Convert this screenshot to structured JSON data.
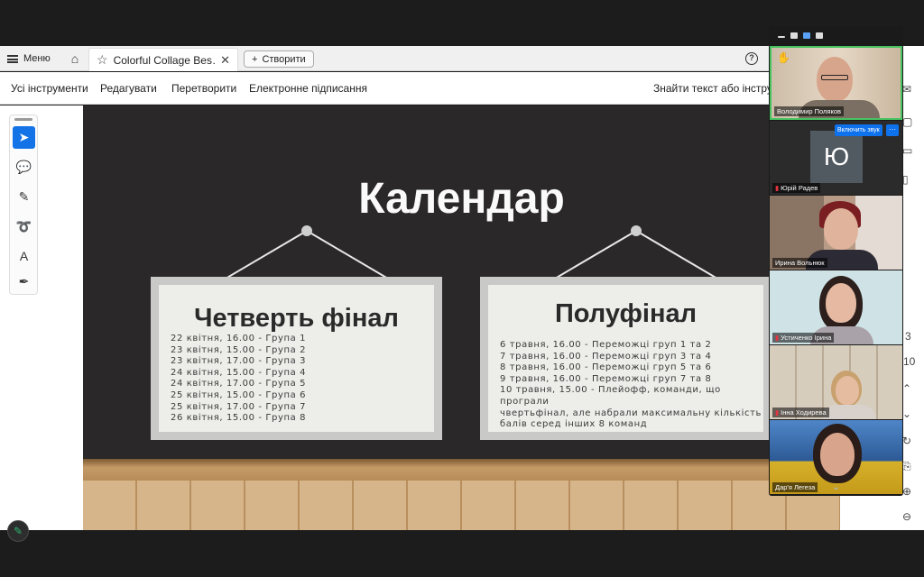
{
  "tabbar": {
    "menu_label": "Меню",
    "tab_title": "Colorful Collage Bes…",
    "create_label": "Створити"
  },
  "menubar": {
    "items": [
      "Усі інструменти",
      "Редагувати",
      "Перетворити",
      "Електронне підписання"
    ],
    "search_text": "Знайти текст або інструм"
  },
  "slide": {
    "title": "Календар",
    "left_board": {
      "title": "Четверть фінал",
      "lines": [
        "22 квітня, 16.00 - Група 1",
        "23 квітня, 15.00 - Група 2",
        "23 квітня, 17.00 - Група 3",
        "24 квітня, 15.00 - Група 4",
        "24 квітня, 17.00 - Група 5",
        "25 квітня, 15.00 - Група 6",
        "25 квітня, 17.00 - Група 7",
        "26 квітня, 15.00 - Група 8"
      ]
    },
    "right_board": {
      "title": "Полуфінал",
      "lines": [
        "6 травня, 16.00 - Переможці груп 1 та 2",
        "7 травня, 16.00 - Переможці груп 3 та 4",
        "8 травня, 16.00 - Переможці груп 5 та 6",
        "9 травня, 16.00 - Переможці груп 7 та 8",
        "10 травня, 15.00 - Плейофф, команди, що програли",
        "чвертьфінал, але набрали максимальну кількість",
        "балів серед інших 8 команд"
      ]
    }
  },
  "participants": {
    "unmute_label": "Включить звук",
    "more_label": "···",
    "avatar_letter": "Ю",
    "tiles": [
      {
        "name": "Володимир Поляков"
      },
      {
        "name": "Юрій Радев"
      },
      {
        "name": "Ирина Вольнюк"
      },
      {
        "name": "Устиченко Ірина"
      },
      {
        "name": "Інна Ходирева"
      },
      {
        "name": "Дар'я Легеза"
      }
    ]
  },
  "side_numbers": [
    "3",
    "10"
  ],
  "colors": {
    "accent": "#1473e6",
    "speaking_border": "#46c35f",
    "zoom_blue": "#0e72ed",
    "slide_bg": "#2a2828"
  }
}
